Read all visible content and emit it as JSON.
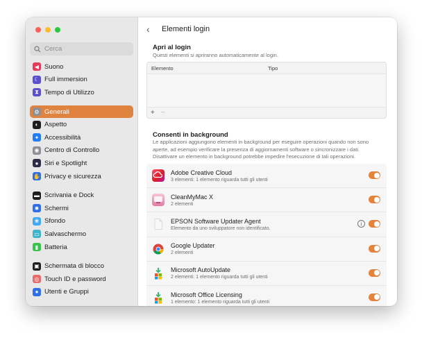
{
  "sidebar": {
    "search_placeholder": "Cerca",
    "groups": [
      [
        {
          "label": "Suono",
          "icon": "speaker-icon",
          "color": "#e63b5a"
        },
        {
          "label": "Full immersion",
          "icon": "moon-icon",
          "color": "#5b4fcf"
        },
        {
          "label": "Tempo di Utilizzo",
          "icon": "hourglass-icon",
          "color": "#5b4fcf"
        }
      ],
      [
        {
          "label": "Generali",
          "icon": "gear-icon",
          "color": "#8e8e93",
          "active": true
        },
        {
          "label": "Aspetto",
          "icon": "appearance-icon",
          "color": "#1d1d1f"
        },
        {
          "label": "Accessibilità",
          "icon": "accessibility-icon",
          "color": "#1f7cf2"
        },
        {
          "label": "Centro di Controllo",
          "icon": "control-center-icon",
          "color": "#8e8e93"
        },
        {
          "label": "Siri e Spotlight",
          "icon": "siri-icon",
          "color": "#2c2c46"
        },
        {
          "label": "Privacy e sicurezza",
          "icon": "hand-icon",
          "color": "#2f6fe8"
        }
      ],
      [
        {
          "label": "Scrivania e Dock",
          "icon": "dock-icon",
          "color": "#1d1d1f"
        },
        {
          "label": "Schermi",
          "icon": "display-icon",
          "color": "#2f6fe8"
        },
        {
          "label": "Sfondo",
          "icon": "wallpaper-icon",
          "color": "#3fa9f5"
        },
        {
          "label": "Salvaschermo",
          "icon": "screensaver-icon",
          "color": "#3fb5c9"
        },
        {
          "label": "Batteria",
          "icon": "battery-icon",
          "color": "#37c44b"
        }
      ],
      [
        {
          "label": "Schermata di blocco",
          "icon": "lock-screen-icon",
          "color": "#1d1d1f"
        },
        {
          "label": "Touch ID e password",
          "icon": "fingerprint-icon",
          "color": "#e86a6a"
        },
        {
          "label": "Utenti e Gruppi",
          "icon": "users-icon",
          "color": "#2f6fe8"
        }
      ]
    ]
  },
  "main": {
    "title": "Elementi login",
    "open_at_login": {
      "title": "Apri al login",
      "subtitle": "Questi elementi si apriranno automaticamente al login.",
      "col_item": "Elemento",
      "col_type": "Tipo",
      "add": "+",
      "remove": "−"
    },
    "background": {
      "title": "Consenti in background",
      "desc_lines": [
        "Le applicazioni aggiungono elementi in background per eseguire operazioni quando non sono",
        "aperte, ad esempio verificare la presenza di aggiornamenti software o sincronizzare i dati.",
        "Disattivare un elemento in background potrebbe impedire l'esecuzione di tali operazioni."
      ],
      "items": [
        {
          "name": "Adobe Creative Cloud",
          "desc": "3 elementi: 1 elemento riguarda tutti gli utenti",
          "enabled": true,
          "icon": "adobe-creative-cloud-icon"
        },
        {
          "name": "CleanMyMac X",
          "desc": "2 elementi",
          "enabled": true,
          "icon": "cleanmymac-icon"
        },
        {
          "name": "EPSON Software Updater Agent",
          "desc": "Elemento da uno sviluppatore non identificato.",
          "enabled": true,
          "icon": "document-icon",
          "info": "i"
        },
        {
          "name": "Google Updater",
          "desc": "2 elementi",
          "enabled": true,
          "icon": "google-chrome-icon"
        },
        {
          "name": "Microsoft AutoUpdate",
          "desc": "2 elementi: 1 elemento riguarda tutti gli utenti",
          "enabled": true,
          "icon": "microsoft-autoupdate-icon"
        },
        {
          "name": "Microsoft Office Licensing",
          "desc": "1 elemento: 1 elemento riguarda tutti gli utenti",
          "enabled": true,
          "icon": "microsoft-office-icon"
        }
      ]
    }
  },
  "colors": {
    "accent": "#e0833f",
    "toggle_on": "#e5833a"
  }
}
